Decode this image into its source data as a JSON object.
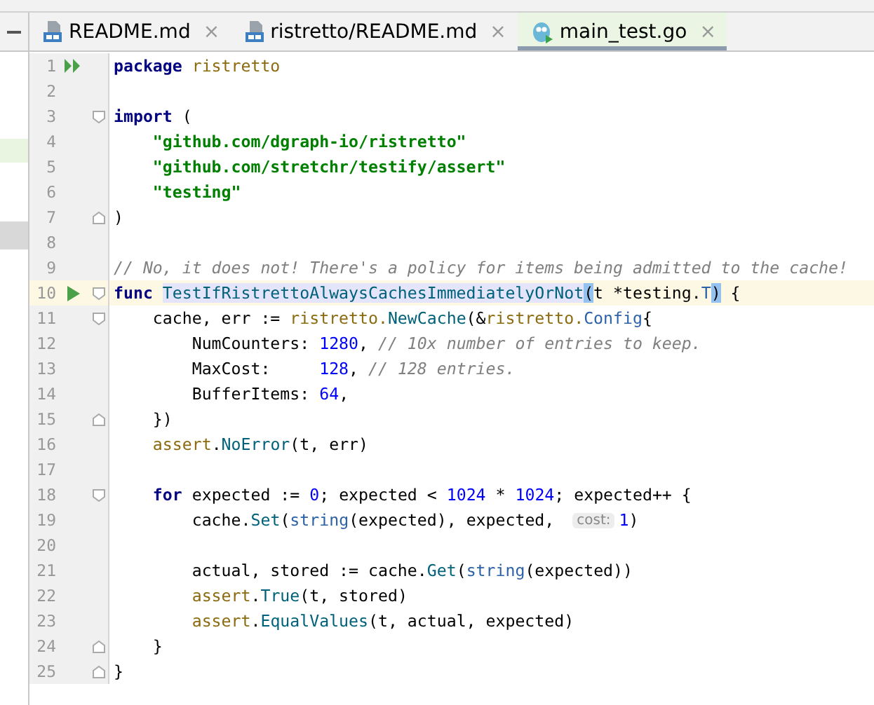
{
  "tabs": [
    {
      "label": "README.md",
      "kind": "markdown",
      "close": "×",
      "selected": false
    },
    {
      "label": "ristretto/README.md",
      "kind": "markdown",
      "close": "×",
      "selected": false
    },
    {
      "label": "main_test.go",
      "kind": "go",
      "close": "×",
      "selected": true
    }
  ],
  "editor": {
    "lines": [
      {
        "number": "1",
        "current": false,
        "gutter": {
          "kind": "run-all"
        },
        "tokens": [
          {
            "text": "package ",
            "kind": "keyword"
          },
          {
            "text": "ristretto",
            "kind": "package"
          }
        ]
      },
      {
        "number": "2",
        "current": false
      },
      {
        "number": "3",
        "current": false,
        "fold": {
          "kind": "start"
        },
        "tokens": [
          {
            "text": "import",
            "kind": "keyword"
          },
          {
            "text": " (",
            "kind": "plain"
          }
        ]
      },
      {
        "number": "4",
        "current": false,
        "tokens": [
          {
            "text": "    \"github.com/dgraph-io/ristretto\"",
            "kind": "string"
          }
        ]
      },
      {
        "number": "5",
        "current": false,
        "tokens": [
          {
            "text": "    \"github.com/stretchr/testify/assert\"",
            "kind": "string"
          }
        ]
      },
      {
        "number": "6",
        "current": false,
        "tokens": [
          {
            "text": "    \"testing\"",
            "kind": "string"
          }
        ]
      },
      {
        "number": "7",
        "current": false,
        "fold": {
          "kind": "end"
        },
        "tokens": [
          {
            "text": ")",
            "kind": "plain"
          }
        ]
      },
      {
        "number": "8",
        "current": false
      },
      {
        "number": "9",
        "current": false,
        "tokens": [
          {
            "text": "// No, it does not! There's a policy for items being admitted to the cache!",
            "kind": "comment"
          }
        ]
      },
      {
        "number": "10",
        "current": true,
        "gutter": {
          "kind": "run"
        },
        "fold": {
          "kind": "start"
        },
        "tokens": [
          {
            "text": "func ",
            "kind": "keyword"
          },
          {
            "text": "TestIfRistrettoAlwaysCachesImmediatelyOrNot",
            "kind": "function",
            "highlight": true
          },
          {
            "text": "(",
            "kind": "plain",
            "highlight": true
          },
          {
            "text": "t *testing.",
            "kind": "plain"
          },
          {
            "text": "T",
            "kind": "type"
          },
          {
            "text": ")",
            "kind": "plain",
            "highlight": true
          },
          {
            "text": " {",
            "kind": "plain"
          }
        ]
      },
      {
        "number": "11",
        "current": false,
        "fold": {
          "kind": "start"
        },
        "tokens": [
          {
            "text": "    cache, err := ",
            "kind": "plain"
          },
          {
            "text": "ristretto.",
            "kind": "package"
          },
          {
            "text": "NewCache",
            "kind": "function"
          },
          {
            "text": "(&",
            "kind": "plain"
          },
          {
            "text": "ristretto.",
            "kind": "package"
          },
          {
            "text": "Config",
            "kind": "type"
          },
          {
            "text": "{",
            "kind": "plain"
          }
        ]
      },
      {
        "number": "12",
        "current": false,
        "tokens": [
          {
            "text": "        NumCounters: ",
            "kind": "plain"
          },
          {
            "text": "1280",
            "kind": "number"
          },
          {
            "text": ", ",
            "kind": "plain"
          },
          {
            "text": "// 10x number of entries to keep.",
            "kind": "comment"
          }
        ]
      },
      {
        "number": "13",
        "current": false,
        "tokens": [
          {
            "text": "        MaxCost:     ",
            "kind": "plain"
          },
          {
            "text": "128",
            "kind": "number"
          },
          {
            "text": ", ",
            "kind": "plain"
          },
          {
            "text": "// 128 entries.",
            "kind": "comment"
          }
        ]
      },
      {
        "number": "14",
        "current": false,
        "tokens": [
          {
            "text": "        BufferItems: ",
            "kind": "plain"
          },
          {
            "text": "64",
            "kind": "number"
          },
          {
            "text": ",",
            "kind": "plain"
          }
        ]
      },
      {
        "number": "15",
        "current": false,
        "fold": {
          "kind": "end"
        },
        "tokens": [
          {
            "text": "    })",
            "kind": "plain"
          }
        ]
      },
      {
        "number": "16",
        "current": false,
        "tokens": [
          {
            "text": "    assert",
            "kind": "package"
          },
          {
            "text": ".",
            "kind": "plain"
          },
          {
            "text": "NoError",
            "kind": "function"
          },
          {
            "text": "(t, err)",
            "kind": "plain"
          }
        ]
      },
      {
        "number": "17",
        "current": false
      },
      {
        "number": "18",
        "current": false,
        "fold": {
          "kind": "start"
        },
        "tokens": [
          {
            "text": "    for",
            "kind": "keyword"
          },
          {
            "text": " expected := ",
            "kind": "plain"
          },
          {
            "text": "0",
            "kind": "number"
          },
          {
            "text": "; expected < ",
            "kind": "plain"
          },
          {
            "text": "1024",
            "kind": "number"
          },
          {
            "text": " * ",
            "kind": "plain"
          },
          {
            "text": "1024",
            "kind": "number"
          },
          {
            "text": "; expected++ {",
            "kind": "plain"
          }
        ]
      },
      {
        "number": "19",
        "current": false,
        "tokens": [
          {
            "text": "        cache.",
            "kind": "plain"
          },
          {
            "text": "Set",
            "kind": "function"
          },
          {
            "text": "(",
            "kind": "plain"
          },
          {
            "text": "string",
            "kind": "type"
          },
          {
            "text": "(expected), expected, ",
            "kind": "plain"
          },
          {
            "text": "cost:",
            "kind": "hint"
          },
          {
            "text": "1",
            "kind": "number"
          },
          {
            "text": ")",
            "kind": "plain"
          }
        ]
      },
      {
        "number": "20",
        "current": false
      },
      {
        "number": "21",
        "current": false,
        "tokens": [
          {
            "text": "        actual, stored := cache.",
            "kind": "plain"
          },
          {
            "text": "Get",
            "kind": "function"
          },
          {
            "text": "(",
            "kind": "plain"
          },
          {
            "text": "string",
            "kind": "type"
          },
          {
            "text": "(expected))",
            "kind": "plain"
          }
        ]
      },
      {
        "number": "22",
        "current": false,
        "tokens": [
          {
            "text": "        assert",
            "kind": "package"
          },
          {
            "text": ".",
            "kind": "plain"
          },
          {
            "text": "True",
            "kind": "function"
          },
          {
            "text": "(t, stored)",
            "kind": "plain"
          }
        ]
      },
      {
        "number": "23",
        "current": false,
        "tokens": [
          {
            "text": "        assert",
            "kind": "package"
          },
          {
            "text": ".",
            "kind": "plain"
          },
          {
            "text": "EqualValues",
            "kind": "function"
          },
          {
            "text": "(t, actual, expected)",
            "kind": "plain"
          }
        ]
      },
      {
        "number": "24",
        "current": false,
        "fold": {
          "kind": "end"
        },
        "tokens": [
          {
            "text": "    }",
            "kind": "plain"
          }
        ]
      },
      {
        "number": "25",
        "current": false,
        "fold": {
          "kind": "end"
        },
        "tokens": [
          {
            "text": "}",
            "kind": "plain"
          }
        ]
      }
    ]
  }
}
